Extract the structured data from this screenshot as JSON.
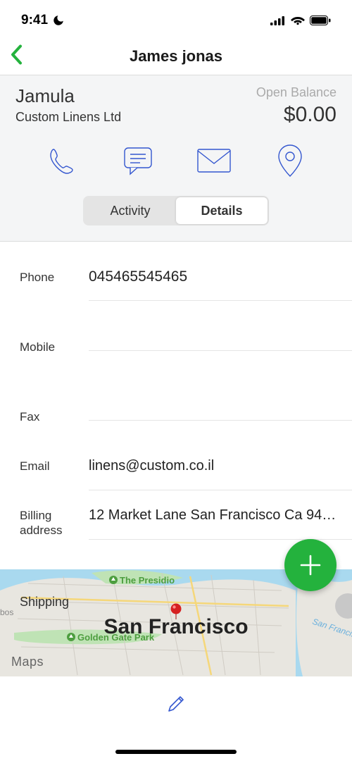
{
  "status": {
    "time": "9:41"
  },
  "nav": {
    "title": "James jonas"
  },
  "customer": {
    "displayName": "Jamula",
    "company": "Custom Linens Ltd",
    "openBalanceLabel": "Open Balance",
    "balance": "$0.00"
  },
  "icons": {
    "phone": "phone-icon",
    "chat": "chat-icon",
    "email": "email-icon",
    "location": "location-icon"
  },
  "tabs": {
    "activity": "Activity",
    "details": "Details",
    "selected": "details"
  },
  "fields": {
    "phoneLabel": "Phone",
    "phoneValue": "045465545465",
    "mobileLabel": "Mobile",
    "mobileValue": "",
    "faxLabel": "Fax",
    "faxValue": "",
    "emailLabel": "Email",
    "emailValue": "linens@custom.co.il",
    "billingLabel": "Billing address",
    "billingValue": "12 Market Lane San Francisco Ca 941…",
    "shippingLabel": "Shipping"
  },
  "map": {
    "city": "San Francisco",
    "presidio": "The Presidio",
    "ggp": "Golden Gate Park",
    "bay": "San Francisco B",
    "bos": "bos",
    "providerLabel": "Maps"
  },
  "colors": {
    "accentGreen": "#24b23d",
    "iconBlue": "#3356cf"
  }
}
